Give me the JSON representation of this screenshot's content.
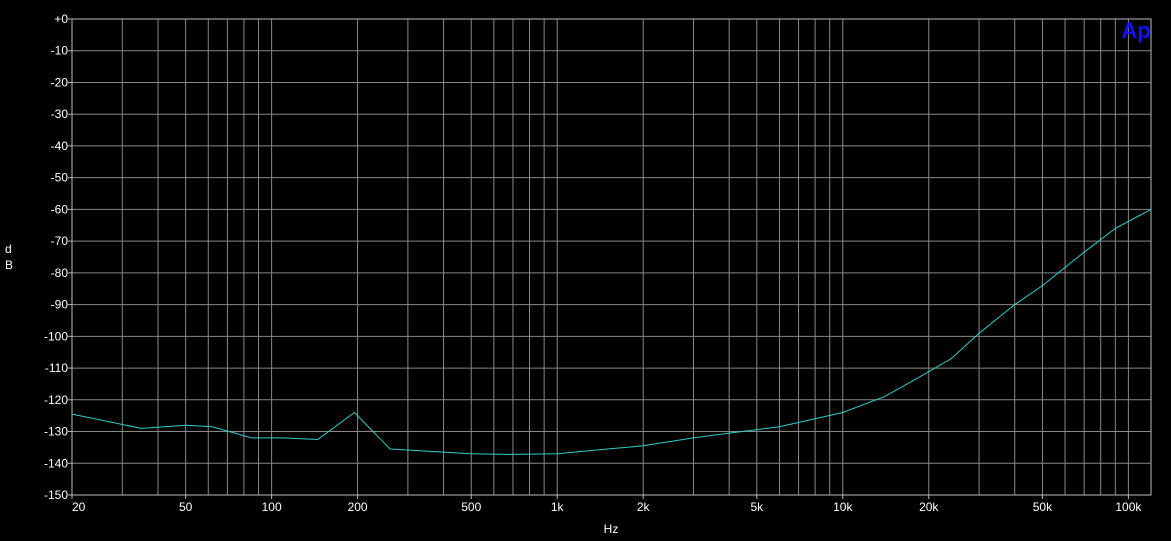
{
  "chart_data": {
    "type": "line",
    "title": "",
    "xlabel": "Hz",
    "ylabel": "dB",
    "x_scale": "log",
    "xlim": [
      20,
      120000
    ],
    "ylim": [
      -150,
      0
    ],
    "grid": true,
    "x_ticks": [
      {
        "value": 20,
        "label": "20"
      },
      {
        "value": 50,
        "label": "50"
      },
      {
        "value": 100,
        "label": "100"
      },
      {
        "value": 200,
        "label": "200"
      },
      {
        "value": 500,
        "label": "500"
      },
      {
        "value": 1000,
        "label": "1k"
      },
      {
        "value": 2000,
        "label": "2k"
      },
      {
        "value": 5000,
        "label": "5k"
      },
      {
        "value": 10000,
        "label": "10k"
      },
      {
        "value": 20000,
        "label": "20k"
      },
      {
        "value": 50000,
        "label": "50k"
      },
      {
        "value": 100000,
        "label": "100k"
      }
    ],
    "y_ticks": [
      {
        "value": 0,
        "label": "+0"
      },
      {
        "value": -10,
        "label": "-10"
      },
      {
        "value": -20,
        "label": "-20"
      },
      {
        "value": -30,
        "label": "-30"
      },
      {
        "value": -40,
        "label": "-40"
      },
      {
        "value": -50,
        "label": "-50"
      },
      {
        "value": -60,
        "label": "-60"
      },
      {
        "value": -70,
        "label": "-70"
      },
      {
        "value": -80,
        "label": "-80"
      },
      {
        "value": -90,
        "label": "-90"
      },
      {
        "value": -100,
        "label": "-100"
      },
      {
        "value": -110,
        "label": "-110"
      },
      {
        "value": -120,
        "label": "-120"
      },
      {
        "value": -130,
        "label": "-130"
      },
      {
        "value": -140,
        "label": "-140"
      },
      {
        "value": -150,
        "label": "-150"
      }
    ],
    "series": [
      {
        "color": "#33cccc",
        "x": [
          20,
          35,
          50,
          62,
          85,
          110,
          145,
          195,
          260,
          500,
          700,
          1000,
          1500,
          2000,
          3000,
          4000,
          6000,
          8000,
          10000,
          14000,
          18000,
          24000,
          30000,
          40000,
          50000,
          70000,
          90000,
          120000
        ],
        "y": [
          -124.5,
          -129,
          -128,
          -128.5,
          -132,
          -132,
          -132.5,
          -124,
          -135.5,
          -137,
          -137.2,
          -137,
          -135.5,
          -134.5,
          -132,
          -130.5,
          -128.5,
          -126,
          -124,
          -119,
          -113.5,
          -107,
          -99,
          -90,
          -84,
          -73.5,
          -66,
          -60
        ]
      }
    ]
  },
  "logo": {
    "text": "Ap",
    "color": "#1010ff"
  },
  "colors": {
    "background": "#000000",
    "grid": "#888888",
    "axis": "#bbbbbb",
    "text": "#ffffff"
  }
}
